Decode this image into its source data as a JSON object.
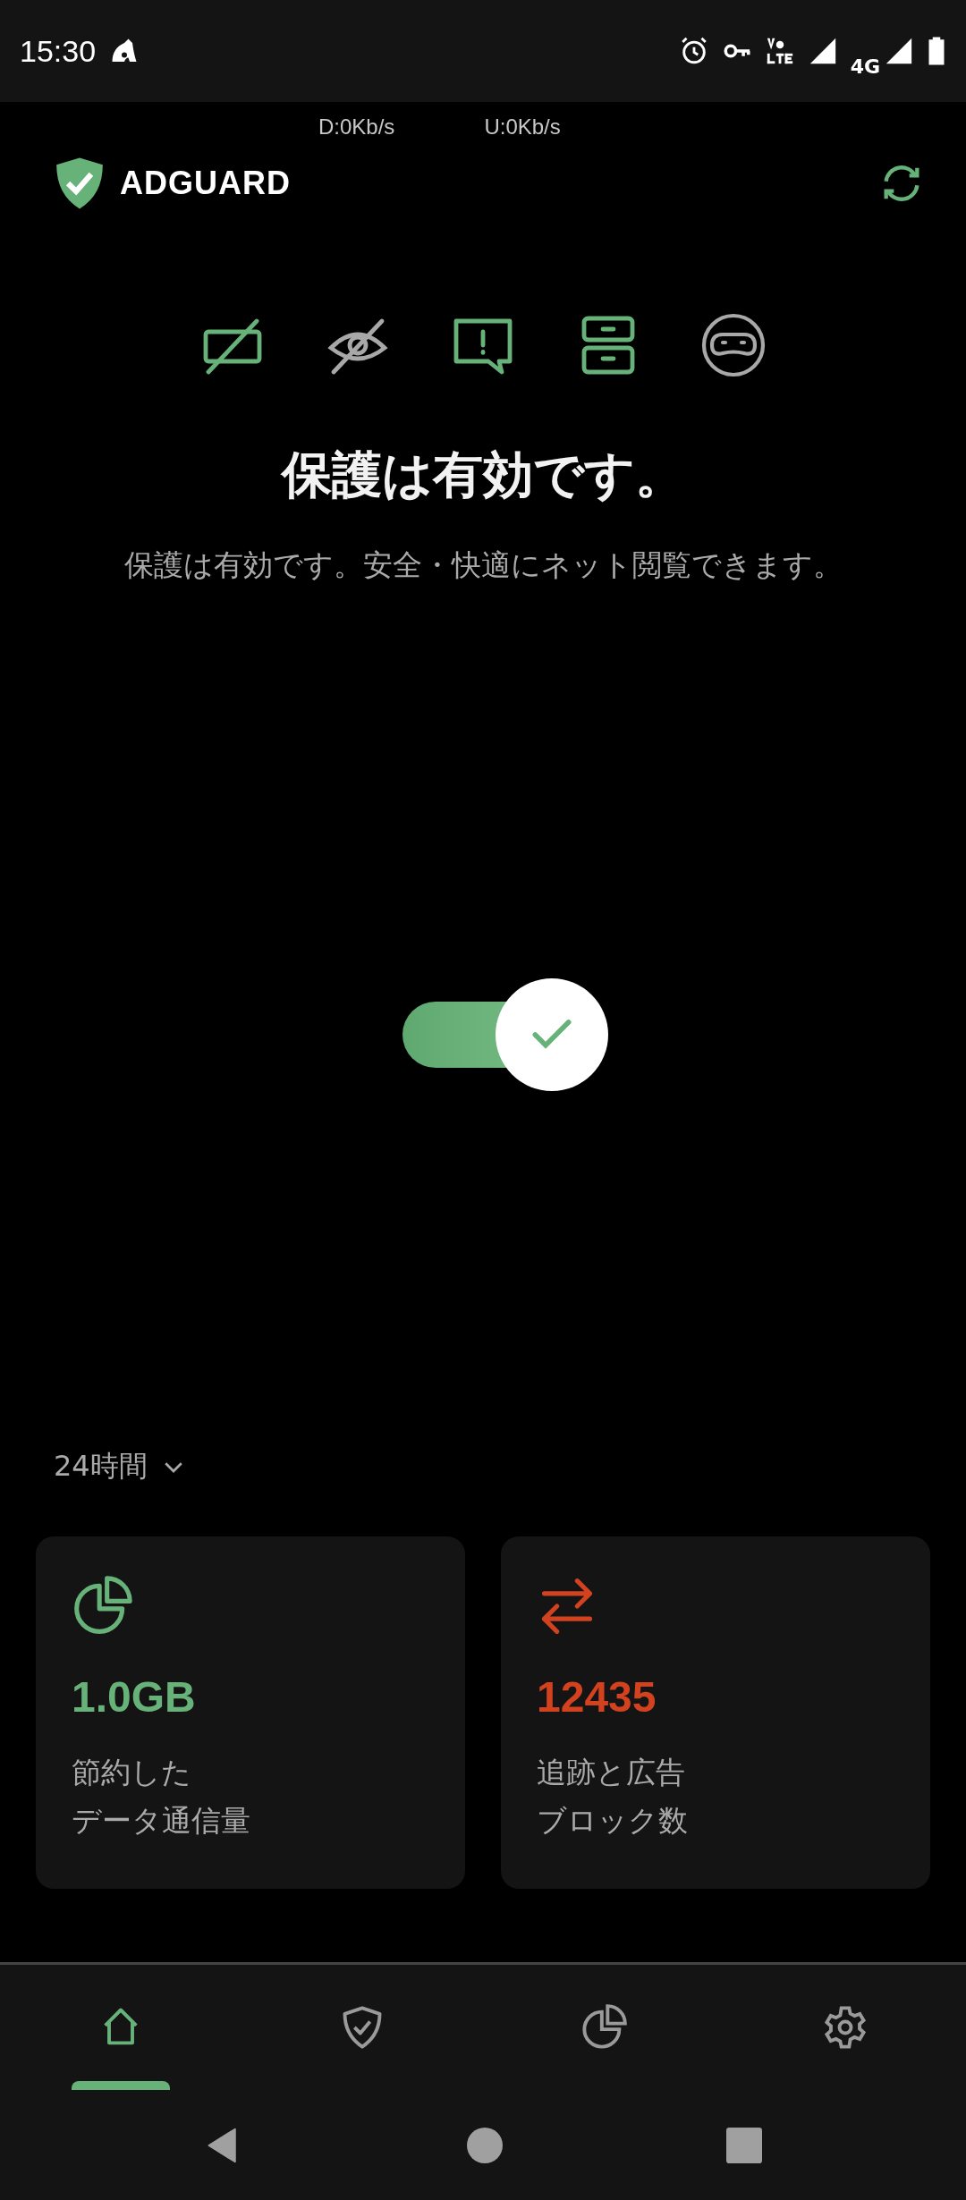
{
  "status_bar": {
    "time": "15:30",
    "network": "4G"
  },
  "speed": {
    "download": "D:0Kb/s",
    "upload": "U:0Kb/s"
  },
  "header": {
    "brand": "ADGUARD"
  },
  "features": [
    {
      "kind": "ads",
      "on": true
    },
    {
      "kind": "tracking",
      "on": false
    },
    {
      "kind": "annoyances",
      "on": true
    },
    {
      "kind": "dns",
      "on": true
    },
    {
      "kind": "stealth",
      "on": false
    }
  ],
  "protection": {
    "title": "保護は有効です。",
    "subtitle": "保護は有効です。安全・快適にネット閲覧できます。",
    "on": true
  },
  "period": {
    "label": "24時間"
  },
  "stats": [
    {
      "kind": "data",
      "value": "1.0GB",
      "label": [
        "節約した",
        "データ通信量"
      ],
      "color": "#67b279"
    },
    {
      "kind": "blocked",
      "value": "12435",
      "label": [
        "追跡と広告",
        "ブロック数"
      ],
      "color": "#d2421f"
    }
  ],
  "nav": [
    {
      "kind": "home",
      "selected": true
    },
    {
      "kind": "protection",
      "selected": false
    },
    {
      "kind": "stats",
      "selected": false
    },
    {
      "kind": "settings",
      "selected": false
    }
  ]
}
